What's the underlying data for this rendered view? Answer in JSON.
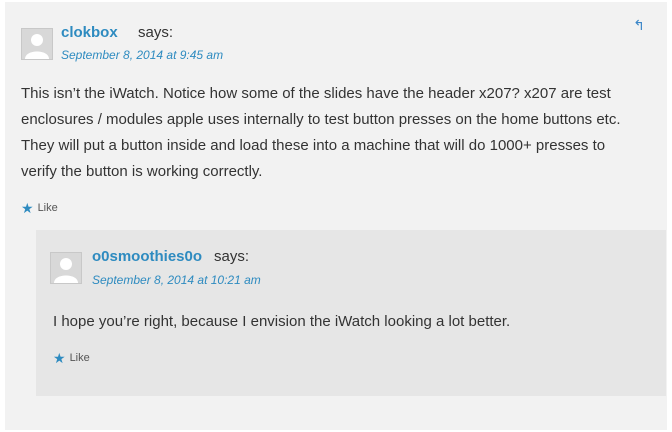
{
  "comment": {
    "author": "clokbox",
    "says": "says:",
    "date": "September 8, 2014 at 9:45 am",
    "body": "This isn’t the iWatch. Notice how some of the slides have the header x207? x207 are test enclosures / modules apple uses internally to test button presses on the home buttons etc. They will put a button inside and load these into a machine that will do 1000+ presses to verify the button is working correctly.",
    "like_label": "Like",
    "reply_icon": "reply-arrow-icon"
  },
  "reply": {
    "author": "o0smoothies0o",
    "says": "says:",
    "date": "September 8, 2014 at 10:21 am",
    "body": "I hope you’re right, because I envision the iWatch looking a lot better.",
    "like_label": "Like"
  },
  "colors": {
    "accent": "#2e8bc0",
    "panel": "#f2f2f2",
    "reply_panel": "#e6e6e6"
  }
}
